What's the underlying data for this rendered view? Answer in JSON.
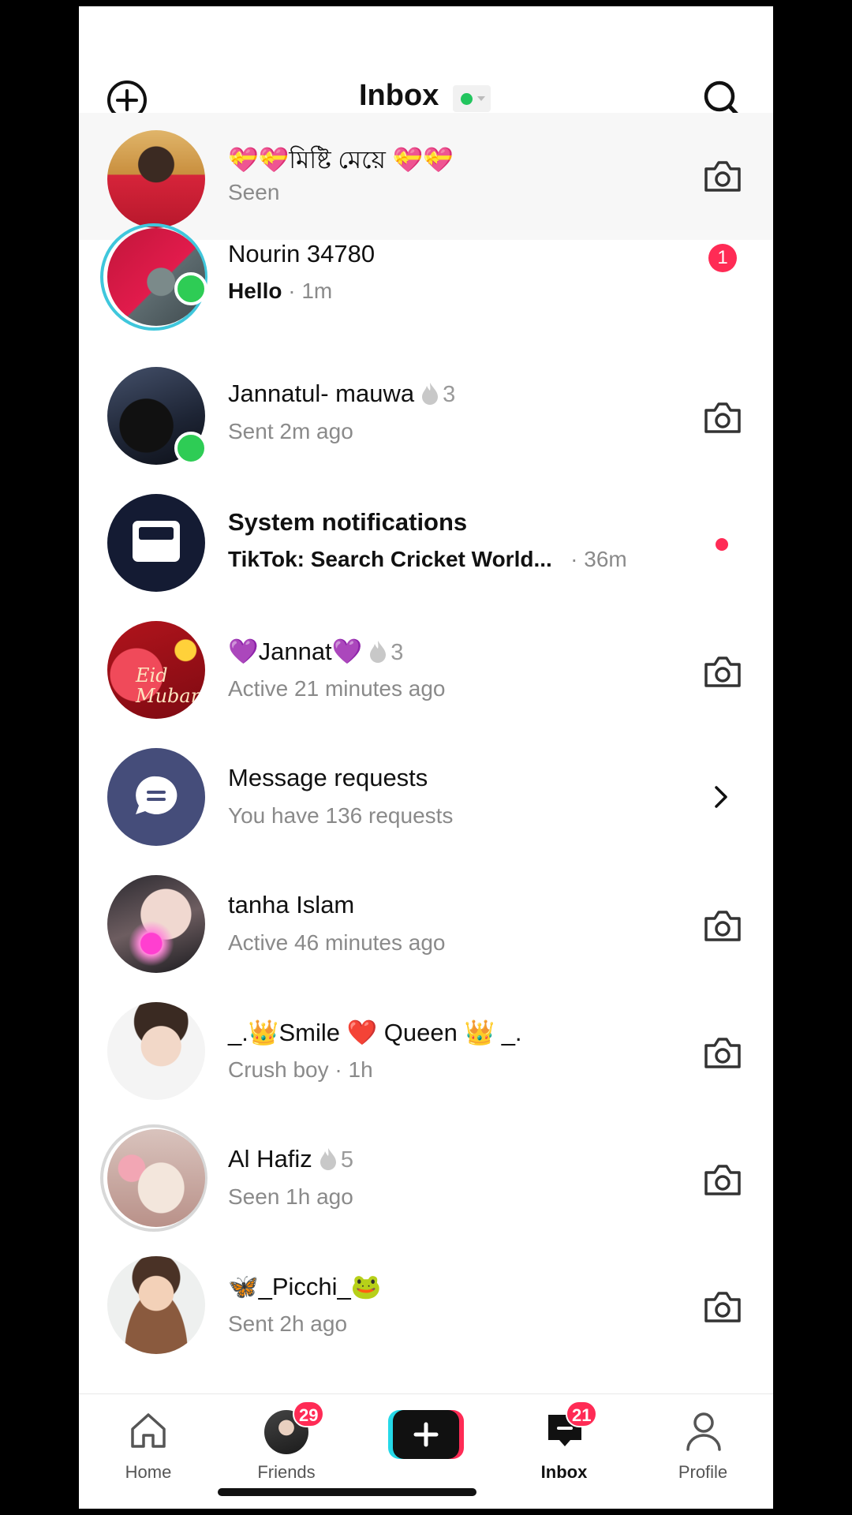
{
  "header": {
    "title": "Inbox",
    "status_color": "#22c55e"
  },
  "conversations": [
    {
      "name": "💝💝মিষ্টি মেয়ে 💝💝",
      "sub": "Seen",
      "action": "camera"
    },
    {
      "name": "Nourin 34780",
      "sub_message": "Hello",
      "sub_time": "· 1m",
      "unread": "1",
      "online": true
    },
    {
      "name": "Jannatul- mauwa",
      "streak": "3",
      "sub": "Sent 2m ago",
      "online": true,
      "action": "camera"
    },
    {
      "name": "System notifications",
      "sub_message": "TikTok: Search Cricket World...",
      "sub_time": "· 36m",
      "dot": true
    },
    {
      "name": "💜Jannat💜",
      "streak": "3",
      "sub": "Active 21 minutes ago",
      "action": "camera",
      "avatar_text": "Eid Mubarak"
    },
    {
      "name": "Message requests",
      "sub": "You have 136 requests",
      "action": "chevron"
    },
    {
      "name": "tanha Islam",
      "sub": "Active 46 minutes ago",
      "action": "camera"
    },
    {
      "name": "_.👑Smile ❤️ Queen 👑 _.",
      "sub": "Crush boy · 1h",
      "action": "camera"
    },
    {
      "name": "Al Hafiz",
      "streak": "5",
      "sub": "Seen 1h ago",
      "action": "camera"
    },
    {
      "name": "🦋_Picchi_🐸",
      "sub": "Sent 2h ago",
      "action": "camera"
    }
  ],
  "tabs": [
    {
      "label": "Home",
      "icon": "home-icon"
    },
    {
      "label": "Friends",
      "badge": "29",
      "icon": "friends-avatar"
    },
    {
      "label": "",
      "icon": "create-plus-icon"
    },
    {
      "label": "Inbox",
      "badge": "21",
      "icon": "inbox-icon",
      "active": true
    },
    {
      "label": "Profile",
      "icon": "profile-icon"
    }
  ],
  "colors": {
    "accent": "#ff2b55",
    "online": "#2ecc55",
    "ring": "#3fc7dc"
  }
}
